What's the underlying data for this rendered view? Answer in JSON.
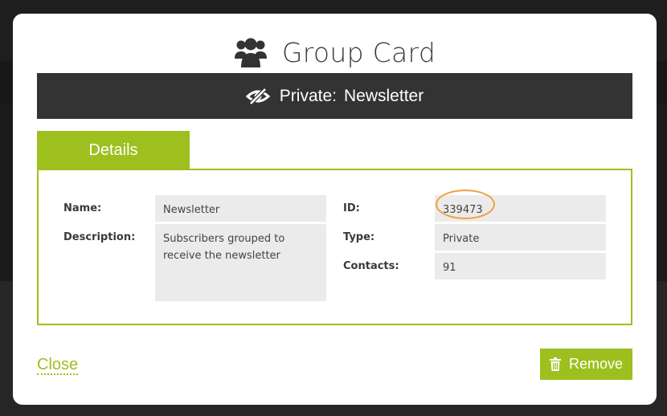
{
  "modal": {
    "title": "Group Card",
    "group_bar": {
      "type": "Private:",
      "name": "Newsletter"
    },
    "tabs": [
      {
        "label": "Details"
      }
    ],
    "details": {
      "name_label": "Name:",
      "name_value": "Newsletter",
      "description_label": "Description:",
      "description_value": "Subscribers grouped to receive the newsletter",
      "id_label": "ID:",
      "id_value": "339473",
      "type_label": "Type:",
      "type_value": "Private",
      "contacts_label": "Contacts:",
      "contacts_value": "91"
    },
    "footer": {
      "close_label": "Close",
      "remove_label": "Remove"
    }
  },
  "colors": {
    "accent": "#9dc01e",
    "header_bar": "#333333",
    "field_bg": "#ebebeb",
    "highlight": "#f0a040"
  },
  "icons": {
    "title": "group-icon",
    "bar": "eye-slash-icon",
    "remove": "trash-icon"
  }
}
